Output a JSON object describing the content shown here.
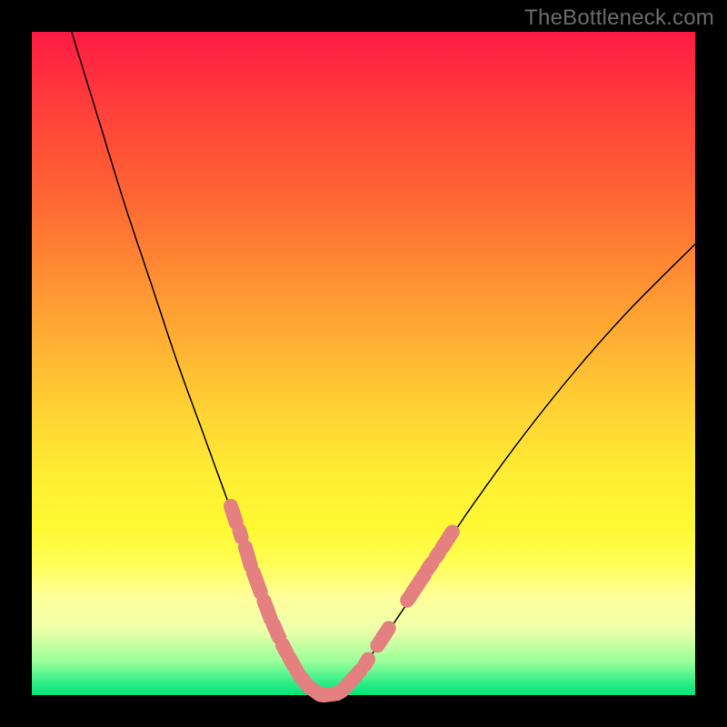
{
  "watermark": "TheBottleneck.com",
  "chart_data": {
    "type": "line",
    "title": "",
    "xlabel": "",
    "ylabel": "",
    "xlim": [
      0,
      100
    ],
    "ylim": [
      0,
      100
    ],
    "grid": false,
    "legend": false,
    "description": "V-shaped bottleneck curve with minimum near center, plotted over vertical red-to-green gradient background. Pink pill-shaped markers highlight segments of the curve near the bottom.",
    "series": [
      {
        "name": "bottleneck-curve",
        "x": [
          6,
          10,
          14,
          18,
          22,
          26,
          30,
          32,
          34,
          36,
          37,
          38,
          39,
          40,
          41,
          42,
          43,
          44,
          45,
          46,
          48,
          50,
          54,
          60,
          66,
          74,
          82,
          90,
          100
        ],
        "y": [
          100,
          87,
          74,
          62,
          50,
          39,
          28,
          23,
          18,
          13,
          10.5,
          8,
          5.5,
          3.5,
          2,
          1,
          0.3,
          0,
          0,
          0.5,
          2,
          4.5,
          10,
          19,
          28,
          39,
          49,
          58,
          68
        ]
      }
    ],
    "markers": [
      {
        "x1": 30.0,
        "y1": 28.5,
        "x2": 30.8,
        "y2": 26.0
      },
      {
        "x1": 31.3,
        "y1": 24.8,
        "x2": 31.6,
        "y2": 23.8
      },
      {
        "x1": 32.2,
        "y1": 22.3,
        "x2": 33.0,
        "y2": 19.5
      },
      {
        "x1": 33.4,
        "y1": 18.5,
        "x2": 34.5,
        "y2": 15.5
      },
      {
        "x1": 35.0,
        "y1": 14.2,
        "x2": 36.0,
        "y2": 11.5
      },
      {
        "x1": 36.4,
        "y1": 10.7,
        "x2": 36.8,
        "y2": 9.8
      },
      {
        "x1": 37.0,
        "y1": 9.3,
        "x2": 37.3,
        "y2": 8.7
      },
      {
        "x1": 37.8,
        "y1": 7.6,
        "x2": 38.4,
        "y2": 6.4
      },
      {
        "x1": 38.8,
        "y1": 5.7,
        "x2": 40.2,
        "y2": 3.2
      },
      {
        "x1": 40.6,
        "y1": 2.7,
        "x2": 41.2,
        "y2": 1.9
      },
      {
        "x1": 41.6,
        "y1": 1.4,
        "x2": 43.5,
        "y2": 0.05
      },
      {
        "x1": 44.0,
        "y1": 0.0,
        "x2": 46.0,
        "y2": 0.25
      },
      {
        "x1": 46.4,
        "y1": 0.45,
        "x2": 46.8,
        "y2": 0.7
      },
      {
        "x1": 47.2,
        "y1": 1.1,
        "x2": 49.5,
        "y2": 3.7
      },
      {
        "x1": 50.2,
        "y1": 4.6,
        "x2": 50.7,
        "y2": 5.4
      },
      {
        "x1": 52.1,
        "y1": 7.5,
        "x2": 52.6,
        "y2": 8.2
      },
      {
        "x1": 52.9,
        "y1": 8.7,
        "x2": 53.8,
        "y2": 10.1
      },
      {
        "x1": 56.6,
        "y1": 14.3,
        "x2": 57.1,
        "y2": 15.0
      },
      {
        "x1": 57.4,
        "y1": 15.5,
        "x2": 59.2,
        "y2": 18.2
      },
      {
        "x1": 59.6,
        "y1": 18.9,
        "x2": 60.3,
        "y2": 19.9
      },
      {
        "x1": 60.9,
        "y1": 20.8,
        "x2": 61.4,
        "y2": 21.5
      },
      {
        "x1": 61.9,
        "y1": 22.3,
        "x2": 63.4,
        "y2": 24.6
      }
    ]
  }
}
